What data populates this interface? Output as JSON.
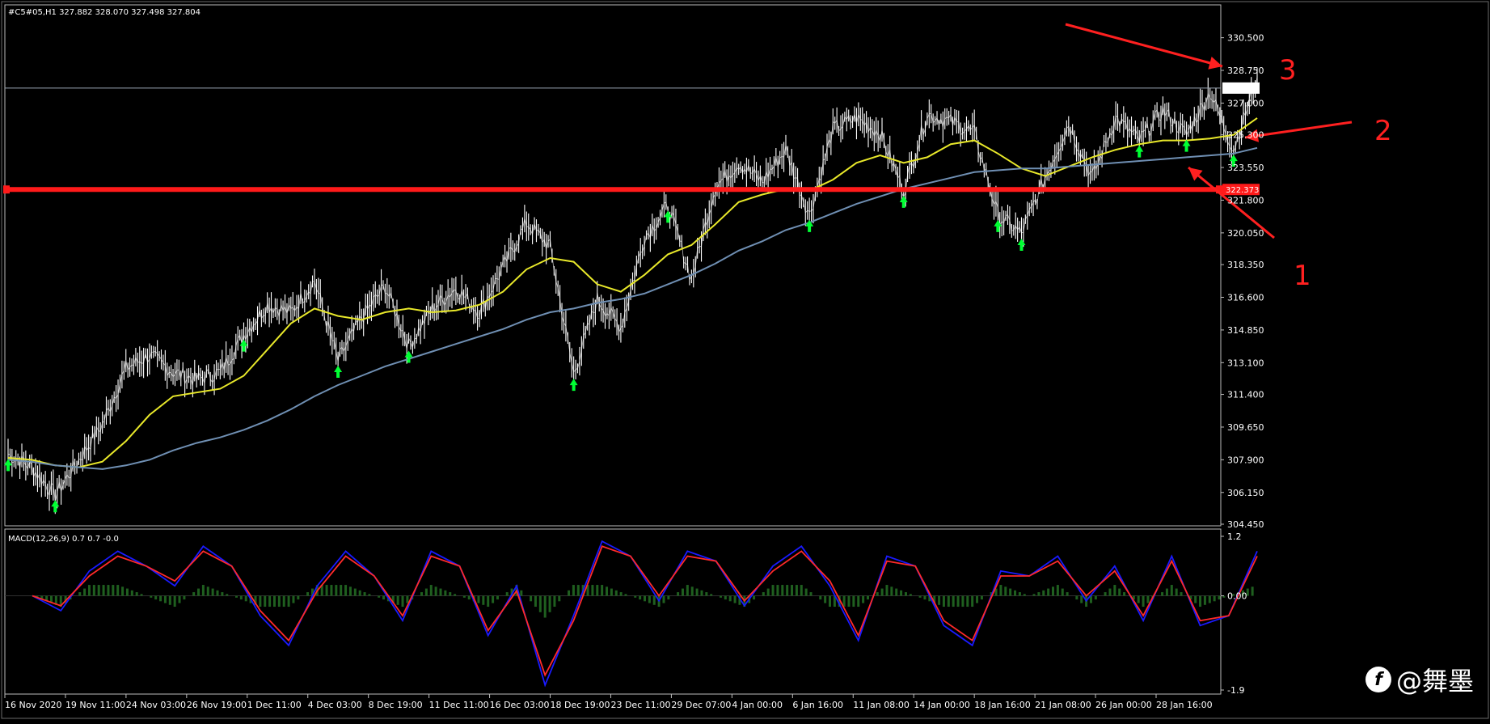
{
  "window": {
    "header_text": "#C5#05,H1  327.882 328.070 327.498 327.804"
  },
  "chart_data": [
    {
      "type": "line",
      "name": "main-price-chart",
      "symbol": "#C5#05",
      "timeframe": "H1",
      "ohlc_last": {
        "open": 327.882,
        "high": 328.07,
        "low": 327.498,
        "close": 327.804
      },
      "ylim": [
        304.45,
        331.35
      ],
      "y_ticks": [
        "330.500",
        "328.750",
        "327.000",
        "325.300",
        "323.550",
        "321.800",
        "320.050",
        "318.350",
        "316.600",
        "314.850",
        "313.100",
        "311.400",
        "309.650",
        "307.900",
        "306.150",
        "304.450"
      ],
      "current_price_label": "327.804",
      "horizontal_level_label": "322.373",
      "horizontal_level_value": 322.373,
      "current_price_value": 327.804,
      "x_labels": [
        "16 Nov 2020",
        "19 Nov 11:00",
        "24 Nov 03:00",
        "26 Nov 19:00",
        "1 Dec 11:00",
        "4 Dec 03:00",
        "8 Dec 19:00",
        "11 Dec 11:00",
        "16 Dec 03:00",
        "18 Dec 19:00",
        "23 Dec 11:00",
        "29 Dec 07:00",
        "4 Jan 00:00",
        "6 Jan 16:00",
        "11 Jan 08:00",
        "14 Jan 00:00",
        "18 Jan 16:00",
        "21 Jan 08:00",
        "26 Jan 00:00",
        "28 Jan 16:00"
      ],
      "price_path": [
        308.2,
        307.5,
        306.0,
        307.9,
        309.8,
        312.8,
        313.5,
        312.6,
        312.2,
        312.6,
        314.6,
        316.2,
        315.8,
        317.5,
        313.2,
        315.5,
        317.2,
        314.0,
        316.0,
        317.1,
        315.8,
        318.2,
        320.6,
        319.3,
        312.5,
        316.5,
        315.0,
        319.8,
        321.5,
        317.6,
        322.5,
        323.8,
        322.8,
        324.5,
        321.0,
        325.6,
        326.2,
        325.4,
        322.3,
        326.4,
        326.0,
        325.4,
        321.0,
        320.0,
        323.0,
        325.9,
        323.0,
        326.2,
        325.0,
        326.6,
        325.3,
        327.6,
        324.5,
        328.4
      ],
      "series": [
        {
          "name": "",
          "color": "#ffffff",
          "values": [
            308.2,
            307.5,
            306.0,
            307.9,
            309.8,
            312.8,
            313.5,
            312.6,
            312.2,
            312.6,
            314.6,
            316.2,
            315.8,
            317.5,
            313.2,
            315.5,
            317.2,
            314.0,
            316.0,
            317.1,
            315.8,
            318.2,
            320.6,
            319.3,
            312.5,
            316.5,
            315.0,
            319.8,
            321.5,
            317.6,
            322.5,
            323.8,
            322.8,
            324.5,
            321.0,
            325.6,
            326.2,
            325.4,
            322.3,
            326.4,
            326.0,
            325.4,
            321.0,
            320.0,
            323.0,
            325.9,
            323.0,
            326.2,
            325.0,
            326.6,
            325.3,
            327.6,
            324.5,
            328.4
          ]
        },
        {
          "name": "",
          "color": "#e8e82a",
          "values": [
            308.0,
            307.9,
            307.6,
            307.5,
            307.8,
            308.9,
            310.3,
            311.3,
            311.5,
            311.7,
            312.4,
            313.8,
            315.2,
            316.0,
            315.6,
            315.4,
            315.8,
            316.0,
            315.8,
            315.9,
            316.2,
            316.9,
            318.1,
            318.7,
            318.5,
            317.3,
            316.9,
            317.8,
            318.9,
            319.4,
            320.5,
            321.7,
            322.1,
            322.4,
            322.3,
            322.9,
            323.8,
            324.2,
            323.8,
            324.1,
            324.8,
            325.0,
            324.3,
            323.5,
            323.1,
            323.6,
            324.1,
            324.5,
            324.8,
            325.0,
            325.0,
            325.1,
            325.3,
            326.2
          ]
        },
        {
          "name": "",
          "color": "#6f8fb3",
          "values": [
            307.9,
            307.8,
            307.6,
            307.5,
            307.4,
            307.6,
            307.9,
            308.4,
            308.8,
            309.1,
            309.5,
            310.0,
            310.6,
            311.3,
            311.9,
            312.4,
            312.9,
            313.3,
            313.7,
            314.1,
            314.5,
            314.9,
            315.4,
            315.8,
            316.0,
            316.3,
            316.5,
            316.8,
            317.3,
            317.8,
            318.4,
            319.1,
            319.6,
            320.2,
            320.6,
            321.1,
            321.6,
            322.0,
            322.4,
            322.7,
            323.0,
            323.3,
            323.4,
            323.5,
            323.5,
            323.6,
            323.7,
            323.8,
            323.9,
            324.0,
            324.1,
            324.2,
            324.3,
            324.6
          ]
        }
      ],
      "signal_arrow_color": "#00ff33",
      "horizontal_level_color": "#ff1a1a",
      "annotations": [
        "1",
        "2",
        "3"
      ]
    },
    {
      "type": "line",
      "name": "macd-panel",
      "title": "MACD(12,26,9) 0.7 0.7 -0.0",
      "ylim": [
        -1.9,
        1.2
      ],
      "y_ticks": [
        "1.2",
        "0.00",
        "-1.9"
      ],
      "series": [
        {
          "name": "",
          "color": "#1a1aff",
          "values": [
            0.0,
            -0.3,
            0.5,
            0.9,
            0.6,
            0.2,
            1.0,
            0.6,
            -0.4,
            -1.0,
            0.2,
            0.9,
            0.4,
            -0.5,
            0.9,
            0.6,
            -0.8,
            0.2,
            -1.8,
            -0.4,
            1.1,
            0.8,
            -0.1,
            0.9,
            0.7,
            -0.2,
            0.6,
            1.0,
            0.2,
            -0.9,
            0.8,
            0.6,
            -0.6,
            -1.0,
            0.5,
            0.4,
            0.8,
            -0.1,
            0.6,
            -0.5,
            0.8,
            -0.6,
            -0.4,
            0.9
          ]
        },
        {
          "name": "",
          "color": "#ff2a2a",
          "values": [
            0.0,
            -0.2,
            0.4,
            0.8,
            0.6,
            0.3,
            0.9,
            0.6,
            -0.3,
            -0.9,
            0.1,
            0.8,
            0.4,
            -0.4,
            0.8,
            0.6,
            -0.7,
            0.1,
            -1.6,
            -0.5,
            1.0,
            0.8,
            0.0,
            0.8,
            0.7,
            -0.1,
            0.5,
            0.9,
            0.3,
            -0.8,
            0.7,
            0.6,
            -0.5,
            -0.9,
            0.4,
            0.4,
            0.7,
            0.0,
            0.5,
            -0.4,
            0.7,
            -0.5,
            -0.4,
            0.8
          ]
        }
      ],
      "histogram_color": "#1f5f1f"
    }
  ],
  "watermark": {
    "logo_glyph": "f",
    "text": "@舞墨"
  }
}
